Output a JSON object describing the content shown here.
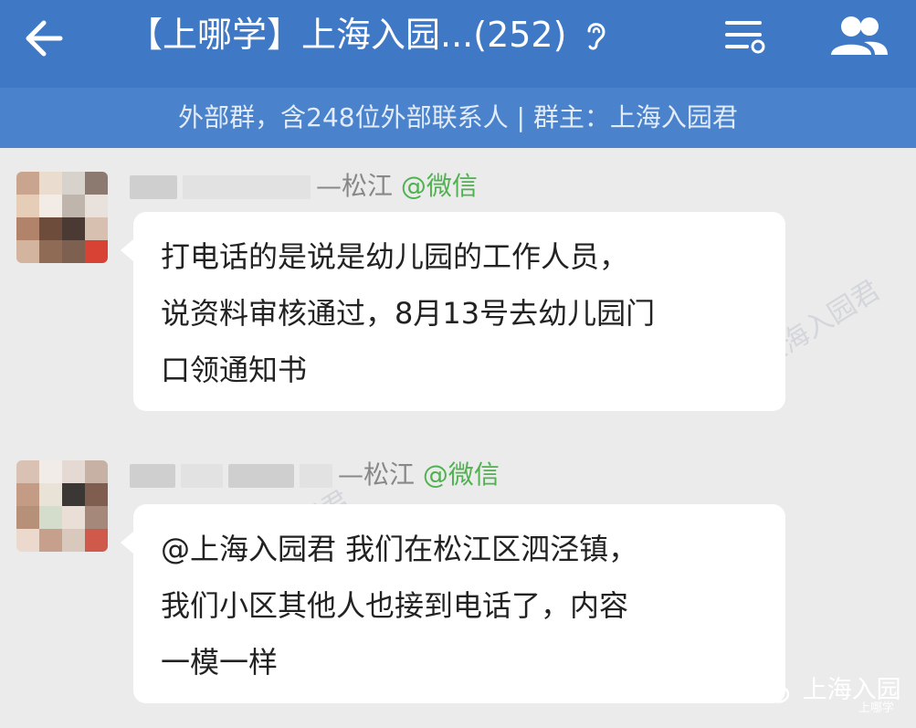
{
  "header": {
    "title": "【上哪学】上海入园...(252)",
    "back_icon": "arrow-left-icon",
    "mode_icon": "ear-icon",
    "menu_icon": "menu-icon",
    "members_icon": "people-icon"
  },
  "subheader": {
    "text": "外部群，含248位外部联系人 | 群主：上海入园君"
  },
  "messages": [
    {
      "sender_suffix": "—松江",
      "sender_source": "@微信",
      "lines": [
        "打电话的是说是幼儿园的工作人员，",
        "说资料审核通过，8月13号去幼儿园门",
        "口领通知书"
      ]
    },
    {
      "sender_suffix": "—松江",
      "sender_source": "@微信",
      "lines": [
        "@上海入园君 我们在松江区泗泾镇，",
        "我们小区其他人也接到电话了，内容",
        "一模一样"
      ]
    }
  ],
  "watermark": {
    "text": "上海入园君",
    "logo_text": "上海入园",
    "logo_sub": "上哪学"
  },
  "colors": {
    "header_bg": "#3f79c6",
    "subheader_bg": "#4a82cc",
    "chat_bg": "#ebebeb",
    "bubble_bg": "#ffffff",
    "source_green": "#4fb14f"
  }
}
